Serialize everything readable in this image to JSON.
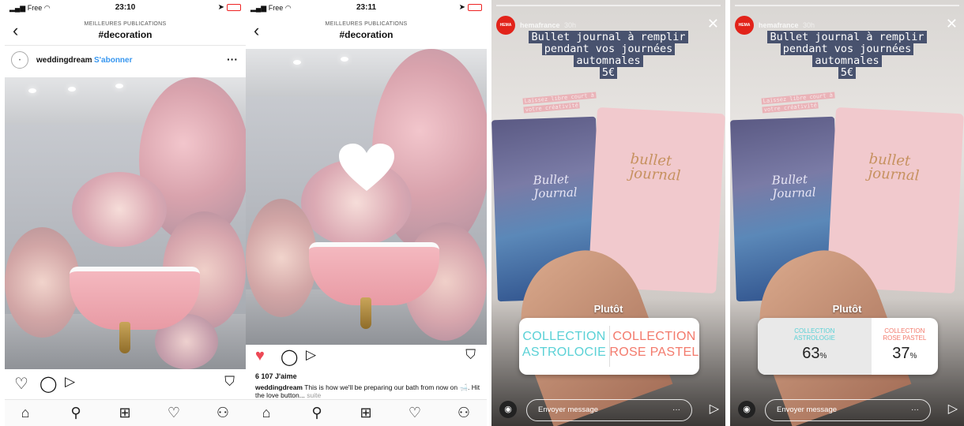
{
  "feed": {
    "carrier": "Free",
    "screens": [
      {
        "time": "23:10"
      },
      {
        "time": "23:11"
      }
    ],
    "nav": {
      "subtitle": "MEILLEURES PUBLICATIONS",
      "title": "#decoration"
    },
    "post": {
      "username": "weddingdream",
      "separator": "·",
      "follow": "S'abonner",
      "likes": "6 107 J'aime",
      "caption_user": "weddingdream",
      "caption_text": " This is how we'll be preparing our bath from now on 🛁. Hit the love button...",
      "caption_more": " suite"
    },
    "icons": {
      "back": "chevron-left-icon",
      "more": "more-horizontal-icon",
      "like": "heart-icon",
      "comment": "comment-icon",
      "share": "send-icon",
      "save": "bookmark-icon",
      "home": "home-icon",
      "search": "search-icon",
      "add": "add-post-icon",
      "activity": "activity-heart-icon",
      "profile": "profile-icon"
    }
  },
  "story": {
    "account": "HEMA",
    "username": "hemafrance",
    "time": "30h",
    "headline": [
      "Bullet journal à remplir",
      "pendant vos journées",
      "automnales",
      "5€"
    ],
    "subtext": [
      "Laissez libre court à",
      "votre créativité"
    ],
    "notebook_blue_title": [
      "Bullet",
      "Journal"
    ],
    "notebook_pink_title": [
      "bullet",
      "journal"
    ],
    "question": "Plutôt",
    "poll": {
      "option_a": [
        "COLLECTION",
        "ASTROLOGIE"
      ],
      "option_b": [
        "COLLECTION",
        "ROSE PASTEL"
      ],
      "option_a_display": [
        "COLLECTION",
        "ASTROLOCIE"
      ],
      "result_a_label": [
        "COLLECTION",
        "ASTROLOGIE"
      ],
      "result_b_label": [
        "COLLECTION",
        "ROSE PASTEL"
      ],
      "result_a_pct": "63",
      "result_b_pct": "37",
      "pct_sign": "%"
    },
    "message_placeholder": "Envoyer message",
    "colors": {
      "hema_red": "#e2231a",
      "poll_a": "#5ad1d6",
      "poll_b": "#f37a6c",
      "headline_bg": "#48526e"
    }
  }
}
